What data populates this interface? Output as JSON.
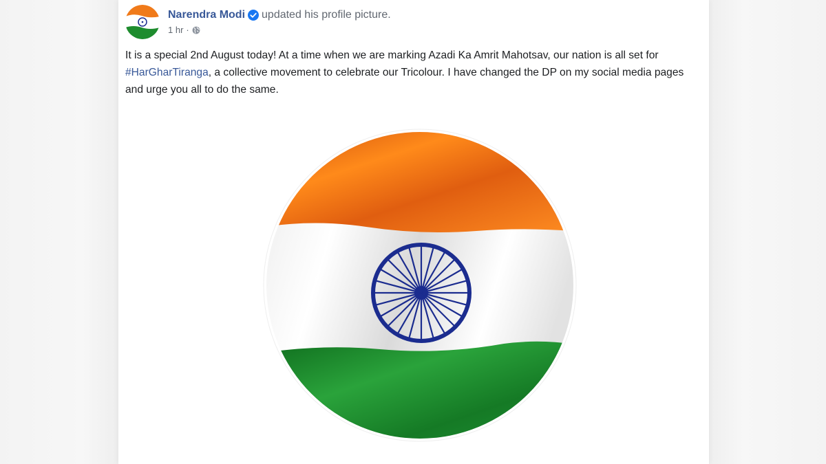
{
  "post": {
    "author": {
      "name": "Narendra Modi",
      "verified": true,
      "action_text": "updated his profile picture."
    },
    "meta": {
      "timestamp": "1 hr",
      "separator": "·",
      "audience_icon": "globe-icon"
    },
    "text": {
      "before_hashtag": "It is a special 2nd August today! At a time when we are marking Azadi Ka Amrit Mahotsav, our nation is all set for ",
      "hashtag": "#HarGharTiranga",
      "after_hashtag": ", a collective movement to celebrate our Tricolour. I have changed the DP on my social media pages and urge you all to do the same."
    },
    "image": {
      "subject": "indian-flag-profile-picture",
      "colors": {
        "saffron": "#FF7F0E",
        "white": "#F4F4F4",
        "green": "#1E8C2E",
        "chakra_navy": "#1B2C8F"
      }
    }
  },
  "theme": {
    "link_color": "#385898",
    "text_color": "#1C1E21",
    "meta_color": "#606770",
    "verified_color": "#1877F2"
  }
}
